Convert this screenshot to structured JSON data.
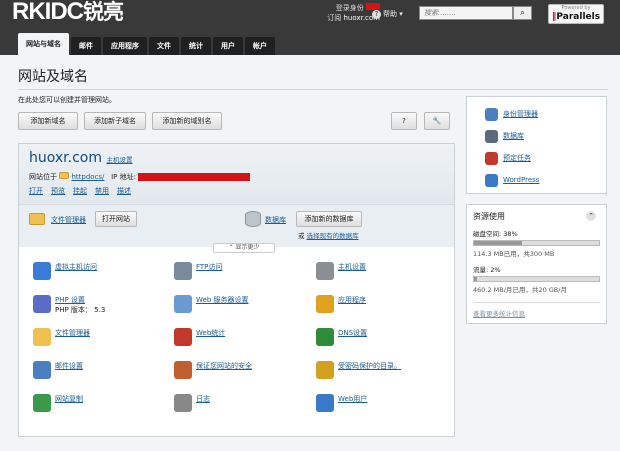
{
  "app": {
    "logo": "RKIDC",
    "logo_cn": "锐亮",
    "brand": "Parallels",
    "brand_small": "Powered by"
  },
  "header": {
    "login_label": "登录身份",
    "subscription_label": "订阅",
    "subscription_value": "huoxr.com",
    "help": "帮助",
    "search_placeholder": "搜索........"
  },
  "tabs": [
    "网站与域名",
    "邮件",
    "应用程序",
    "文件",
    "统计",
    "用户",
    "帐户"
  ],
  "page": {
    "title": "网站及域名",
    "intro": "在此处您可以创建并管理网站。"
  },
  "buttons": {
    "add_domain": "添加新域名",
    "add_subdomain": "添加新子域名",
    "add_alias": "添加新的域别名",
    "help_q": "?"
  },
  "site": {
    "domain": "huoxr.com",
    "host_settings": "主机设置",
    "location_label": "网站位于",
    "location_value": "httpdocs/",
    "ip_label": "IP 地址:",
    "actions": [
      "打开",
      "预览",
      "挂起",
      "禁用",
      "描述"
    ]
  },
  "strip": {
    "file_manager": "文件管理器",
    "open_site": "打开网站",
    "databases": "数据库",
    "add_db": "添加新的数据库",
    "or": "或",
    "select_db": "选择现有的数据库",
    "show_less": "显示更少"
  },
  "features": [
    {
      "label": "虚拟主机访问",
      "icon": "globe-icon"
    },
    {
      "label": "FTP访问",
      "icon": "ftp-icon"
    },
    {
      "label": "主机设置",
      "icon": "server-icon"
    },
    {
      "label": "PHP 设置",
      "sub": "PHP 版本： 5.3",
      "icon": "php-icon"
    },
    {
      "label": "Web 服务器设置",
      "icon": "web-server-icon"
    },
    {
      "label": "应用程序",
      "icon": "gear-icon"
    },
    {
      "label": "文件管理器",
      "icon": "folder-icon"
    },
    {
      "label": "Web统计",
      "icon": "chart-icon"
    },
    {
      "label": "DNS设置",
      "icon": "flags-icon"
    },
    {
      "label": "邮件设置",
      "icon": "mail-icon"
    },
    {
      "label": "保证您网站的安全",
      "icon": "certificate-icon"
    },
    {
      "label": "受密码保护的目录。",
      "icon": "lock-folder-icon"
    },
    {
      "label": "网站复制",
      "icon": "copy-icon"
    },
    {
      "label": "日志",
      "icon": "log-icon"
    },
    {
      "label": "Web用户",
      "icon": "users-icon"
    }
  ],
  "sidebar": {
    "links": [
      "身份管理器",
      "数据库",
      "预定任务",
      "WordPress"
    ],
    "resources_title": "资源使用",
    "disk_label": "磁盘空间: 38%",
    "disk_fraction": 0.38,
    "disk_detail": "114.3 MB已用，共300 MB",
    "traffic_label": "流量: 2%",
    "traffic_fraction": 0.02,
    "traffic_detail": "460.2 MB/月已用，共20 GB/月",
    "more_stats": "查看更多统计信息"
  },
  "colors": {
    "topbar": "#393939",
    "link": "#1a5c99",
    "accent_red": "#d41414"
  }
}
